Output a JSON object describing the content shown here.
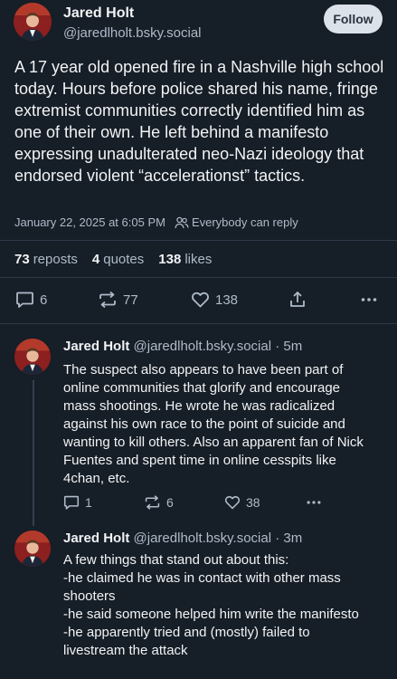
{
  "main_post": {
    "author_name": "Jared Holt",
    "author_handle": "@jaredlholt.bsky.social",
    "follow_label": "Follow",
    "text": "A 17 year old opened fire in a Nashville high school today. Hours before police shared his name, fringe extremist communities correctly identified him as one of their own. He left behind a manifesto expressing unadulterated neo-Nazi ideology that endorsed violent “accelerationst” tactics.",
    "timestamp": "January 22, 2025 at 6:05 PM",
    "separator": "·",
    "reply_setting": "Everybody can reply",
    "stats": {
      "reposts_count": "73",
      "reposts_label": "reposts",
      "quotes_count": "4",
      "quotes_label": "quotes",
      "likes_count": "138",
      "likes_label": "likes"
    },
    "actions": {
      "replies": "6",
      "reposts": "77",
      "likes": "138"
    }
  },
  "replies": [
    {
      "author_name": "Jared Holt",
      "author_handle": "@jaredlholt.bsky.social",
      "time": "· 5m",
      "text": "The suspect also appears to have been part of online communities that glorify and encourage mass shootings. He wrote he was radicalized against his own race to the point of suicide and wanting to kill others. Also an apparent fan of Nick Fuentes and spent time in online cesspits like 4chan, etc.",
      "replies": "1",
      "reposts": "6",
      "likes": "38"
    },
    {
      "author_name": "Jared Holt",
      "author_handle": "@jaredlholt.bsky.social",
      "time": "· 3m",
      "text": "A few things that stand out about this:\n-he claimed he was in contact with other mass shooters\n-he said someone helped him write the manifesto\n-he apparently tried and (mostly) failed to livestream the attack"
    }
  ],
  "icons": {
    "reply": "speech-bubble-icon",
    "repost": "repost-arrows-icon",
    "like": "heart-icon",
    "share": "share-icon",
    "more": "ellipsis-icon",
    "audience": "people-icon"
  },
  "colors": {
    "background": "#161e27",
    "text": "#f1f3f5",
    "muted": "#aebbc9",
    "follow_button": "#dce2ea"
  }
}
